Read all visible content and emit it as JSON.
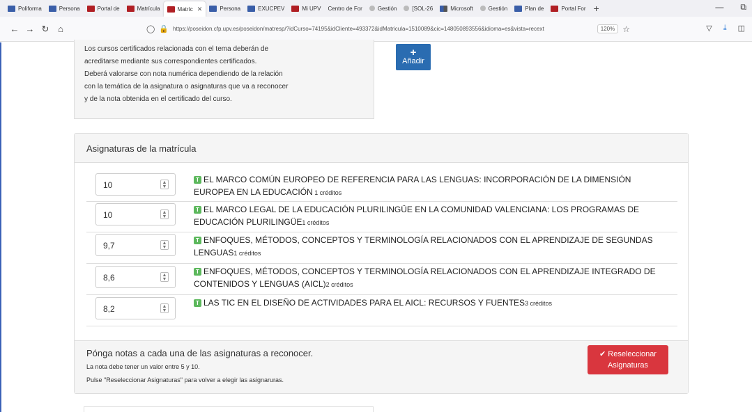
{
  "browser": {
    "tabs": [
      {
        "label": "Poliforma",
        "icon": "blue"
      },
      {
        "label": "Persona",
        "icon": "blue"
      },
      {
        "label": "Portal de",
        "icon": "red"
      },
      {
        "label": "Matrícula",
        "icon": "red"
      },
      {
        "label": "Matríc",
        "icon": "red",
        "active": true
      },
      {
        "label": "Persona",
        "icon": "blue"
      },
      {
        "label": "EXUCPEV",
        "icon": "blue"
      },
      {
        "label": "Mi UPV",
        "icon": "red"
      },
      {
        "label": "Centro de For",
        "icon": "none"
      },
      {
        "label": "Gestión",
        "icon": "gray"
      },
      {
        "label": "[SOL-26",
        "icon": "gray"
      },
      {
        "label": "Microsoft",
        "icon": "ms"
      },
      {
        "label": "Gestión",
        "icon": "gray"
      },
      {
        "label": "Plan de",
        "icon": "blue"
      },
      {
        "label": "Portal For",
        "icon": "red"
      }
    ],
    "active_close": "✕",
    "new_tab": "+",
    "url": "https://poseidon.cfp.upv.es/poseidon/matresp/?idCurso=74195&idCliente=493372&idMatricula=1510089&cic=148050893556&idioma=es&vista=recext",
    "zoom": "120%"
  },
  "top_card": {
    "lines": [
      "Los cursos certificados relacionada con el tema deberán de",
      "acreditarse mediante sus correspondientes certificados.",
      "Deberá valorarse con nota numérica dependiendo de la relación",
      "con la temática de la asignatura o asignaturas que va a reconocer",
      "y de la nota obtenida en el certificado del curso."
    ],
    "add_icon": "+",
    "add_label": "Añadir"
  },
  "panel": {
    "title": "Asignaturas de la matrícula",
    "type_badge": "T",
    "subjects": [
      {
        "grade": "10",
        "name_line1": "EL MARCO COMÚN EUROPEO DE REFERENCIA PARA LAS LENGUAS: INCORPORACIÓN DE LA DIMENSIÓN",
        "name_line2": "EUROPEA EN LA EDUCACIÓN",
        "credits": " 1 créditos"
      },
      {
        "grade": "10",
        "name_line1": "EL MARCO LEGAL DE LA EDUCACIÓN PLURILINGÜE EN LA COMUNIDAD VALENCIANA: LOS PROGRAMAS DE",
        "name_line2": "EDUCACIÓN PLURILINGÜE",
        "credits": "1 créditos"
      },
      {
        "grade": "9,7",
        "name_line1": "ENFOQUES, MÉTODOS, CONCEPTOS Y TERMINOLOGÍA RELACIONADOS CON EL APRENDIZAJE DE SEGUNDAS",
        "name_line2": "LENGUAS",
        "credits": "1 créditos"
      },
      {
        "grade": "8,6",
        "name_line1": "ENFOQUES, MÉTODOS, CONCEPTOS Y TERMINOLOGÍA RELACIONADOS CON EL APRENDIZAJE INTEGRADO DE",
        "name_line2": "CONTENIDOS Y LENGUAS (AICL)",
        "credits": "2 créditos"
      },
      {
        "grade": "8,2",
        "name_line1": "LAS TIC EN EL DISEÑO DE ACTIVIDADES PARA EL AICL: RECURSOS Y FUENTES",
        "name_line2": "",
        "credits": "3 créditos"
      }
    ],
    "footer": {
      "title": "Pónga notas a cada una de las asignaturas a reconocer.",
      "note1": "La nota debe tener un valor entre 5 y 10.",
      "note2": "Pulse \"Reseleccionar Asignaturas\" para volver a elegir las asignaruras.",
      "button_line1": "✔ Reseleccionar",
      "button_line2": "Asignaturas"
    }
  },
  "colors": {
    "add_button": "#2a6cb1",
    "reselect_button": "#d9363e",
    "badge": "#5cb85c"
  }
}
